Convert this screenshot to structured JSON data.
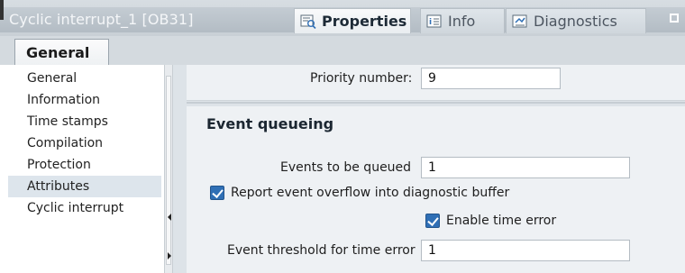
{
  "window": {
    "title": "Cyclic interrupt_1 [OB31]",
    "tabs": [
      {
        "label": "Properties",
        "icon": "properties-icon",
        "active": true
      },
      {
        "label": "Info",
        "icon": "info-icon",
        "active": false
      },
      {
        "label": "Diagnostics",
        "icon": "diagnostics-icon",
        "active": false
      }
    ]
  },
  "general_tab": {
    "label": "General"
  },
  "nav": {
    "items": [
      {
        "label": "General"
      },
      {
        "label": "Information"
      },
      {
        "label": "Time stamps"
      },
      {
        "label": "Compilation"
      },
      {
        "label": "Protection"
      },
      {
        "label": "Attributes",
        "selected": true
      },
      {
        "label": "Cyclic interrupt"
      }
    ]
  },
  "form": {
    "priority_label": "Priority number:",
    "priority_value": "9",
    "section_title": "Event queueing",
    "events_label": "Events to be queued",
    "events_value": "1",
    "report_overflow_label": "Report event overflow into diagnostic buffer",
    "report_overflow_checked": true,
    "enable_time_error_label": "Enable time error",
    "enable_time_error_checked": true,
    "threshold_label": "Event threshold for time error",
    "threshold_value": "1"
  },
  "colors": {
    "accent": "#2f6fb5",
    "selected_nav": "#dde5ec",
    "panel_bg": "#eef1f4"
  }
}
